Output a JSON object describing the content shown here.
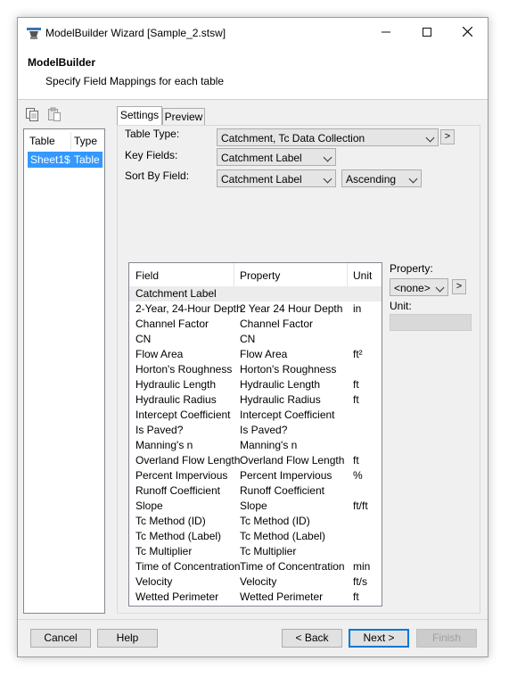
{
  "window": {
    "title": "ModelBuilder Wizard [Sample_2.stsw]"
  },
  "header": {
    "title": "ModelBuilder",
    "subtitle": "Specify Field Mappings for each table"
  },
  "toolbar": {
    "icons": [
      "copy-icon",
      "paste-icon"
    ]
  },
  "tables": {
    "headers": [
      "Table",
      "Type"
    ],
    "rows": [
      {
        "table": "Sheet1$",
        "type": "Table",
        "selected": true
      }
    ]
  },
  "tabs": [
    {
      "label": "Settings",
      "active": true
    },
    {
      "label": "Preview",
      "active": false
    }
  ],
  "settings": {
    "table_type_label": "Table Type:",
    "table_type_value": "Catchment, Tc Data Collection",
    "key_fields_label": "Key Fields:",
    "key_fields_value": "Catchment Label",
    "sort_by_label": "Sort By Field:",
    "sort_by_value": "Catchment Label",
    "sort_order_value": "Ascending",
    "more_button": ">"
  },
  "grid": {
    "headers": [
      "Field",
      "Property",
      "Unit"
    ],
    "rows": [
      [
        "Catchment Label",
        "",
        ""
      ],
      [
        "2-Year, 24-Hour Depth",
        "2 Year 24 Hour Depth",
        "in"
      ],
      [
        "Channel Factor",
        "Channel Factor",
        ""
      ],
      [
        "CN",
        "CN",
        ""
      ],
      [
        "Flow Area",
        "Flow Area",
        "ft²"
      ],
      [
        "Horton's Roughness",
        "Horton's Roughness",
        ""
      ],
      [
        "Hydraulic Length",
        "Hydraulic Length",
        "ft"
      ],
      [
        "Hydraulic Radius",
        "Hydraulic Radius",
        "ft"
      ],
      [
        "Intercept Coefficient",
        "Intercept Coefficient",
        ""
      ],
      [
        "Is Paved?",
        "Is Paved?",
        ""
      ],
      [
        "Manning's n",
        "Manning's n",
        ""
      ],
      [
        "Overland Flow Length",
        "Overland Flow Length",
        "ft"
      ],
      [
        "Percent Impervious",
        "Percent Impervious",
        "%"
      ],
      [
        "Runoff Coefficient",
        "Runoff Coefficient",
        ""
      ],
      [
        "Slope",
        "Slope",
        "ft/ft"
      ],
      [
        "Tc Method (ID)",
        "Tc Method (ID)",
        ""
      ],
      [
        "Tc Method (Label)",
        "Tc Method (Label)",
        ""
      ],
      [
        "Tc Multiplier",
        "Tc Multiplier",
        ""
      ],
      [
        "Time of Concentration",
        "Time of Concentration",
        "min"
      ],
      [
        "Velocity",
        "Velocity",
        "ft/s"
      ],
      [
        "Wetted Perimeter",
        "Wetted Perimeter",
        "ft"
      ]
    ]
  },
  "property_panel": {
    "property_label": "Property:",
    "property_value": "<none>",
    "more_button": ">",
    "unit_label": "Unit:"
  },
  "buttons": {
    "cancel": "Cancel",
    "help": "Help",
    "back": "< Back",
    "next": "Next >",
    "finish": "Finish"
  }
}
